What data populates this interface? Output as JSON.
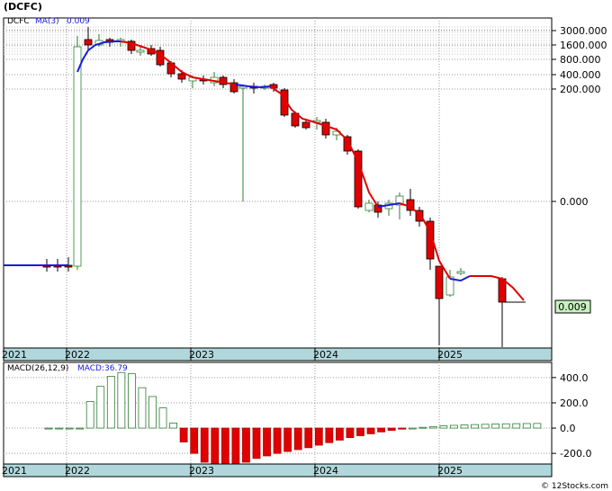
{
  "chart_data": [
    {
      "type": "candlestick",
      "title": "(DCFC)",
      "symbol": "DCFC",
      "indicator_label": "MA(3)",
      "indicator_value": "0.009",
      "last_price_label": "0.009",
      "y_scale": "log",
      "y_tick_labels": [
        "3000.000",
        "1600.000",
        "800.000",
        "400.000",
        "200.000",
        "0.000"
      ],
      "x_tick_labels": [
        "2021",
        "2022",
        "2023",
        "2024",
        "2025"
      ],
      "colors": {
        "up": "#2e7d32",
        "down": "#e00000",
        "ma_up": "#1a1adc",
        "ma_down": "#e00000",
        "axis_band": "#b0d8dc",
        "last_box": "#c8f0c0"
      }
    },
    {
      "type": "bar",
      "title": "MACD(26,12,9)",
      "indicator_label": "MACD:36.79",
      "indicator_value": "36.79",
      "y_tick_labels": [
        "400.0",
        "200.0",
        "0.0",
        "-200.0"
      ],
      "y_ticks": [
        400,
        200,
        0,
        -200
      ],
      "ylim": [
        -270,
        470
      ],
      "x_tick_labels": [
        "2021",
        "2022",
        "2023",
        "2024",
        "2025"
      ],
      "values": [
        0,
        0,
        0,
        0,
        210,
        330,
        410,
        440,
        430,
        320,
        250,
        160,
        40,
        -110,
        -200,
        -270,
        -300,
        -300,
        -290,
        -270,
        -240,
        -220,
        -200,
        -185,
        -170,
        -155,
        -135,
        -115,
        -95,
        -75,
        -60,
        -45,
        -30,
        -18,
        -8,
        0,
        6,
        12,
        18,
        22,
        25,
        28,
        30,
        33,
        34,
        35,
        36,
        36.79
      ],
      "colors": {
        "positive": "#2e7d32",
        "negative": "#e00000"
      }
    }
  ],
  "footer": {
    "copyright": "© 12Stocks.com"
  }
}
